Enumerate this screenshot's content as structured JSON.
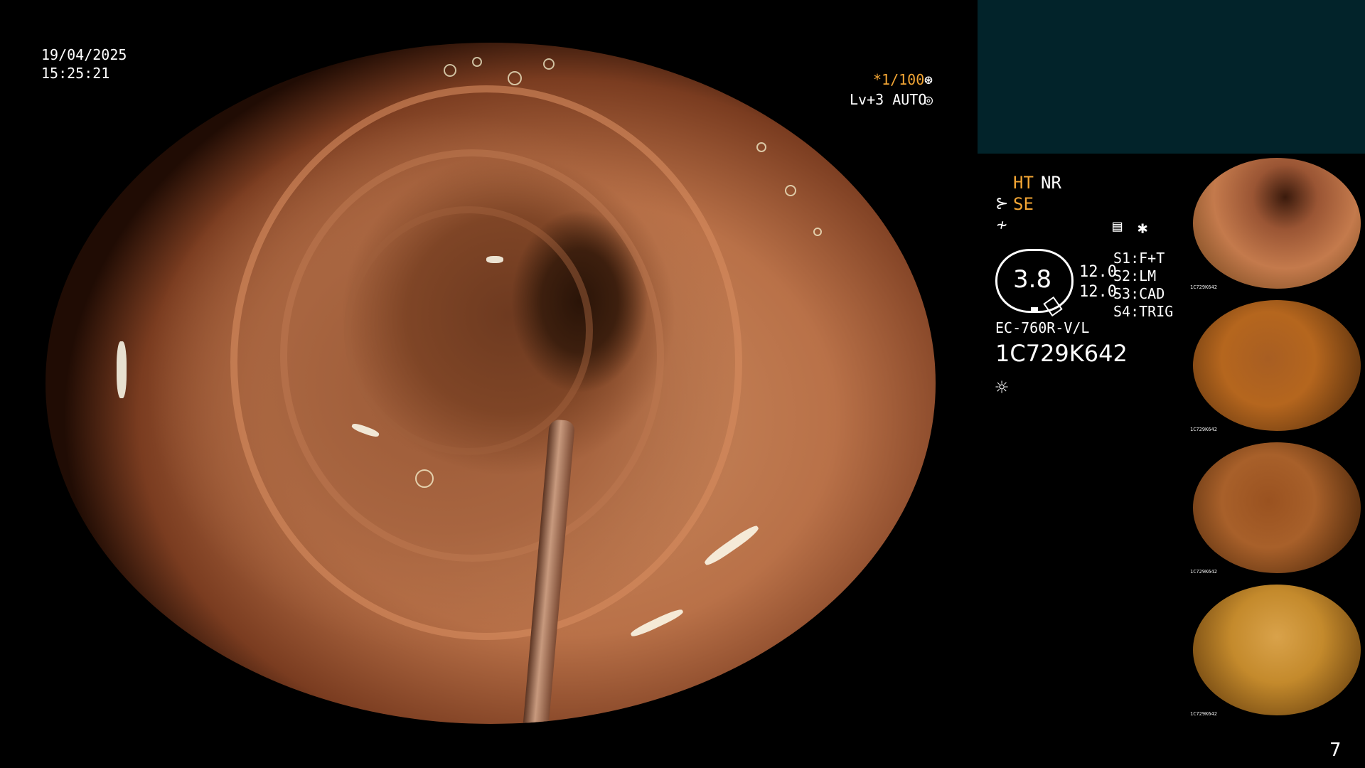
{
  "overlay": {
    "date": "19/04/2025",
    "time": "15:25:21",
    "shutter": "*1/100",
    "level": "Lv+3 AUTO"
  },
  "settings": {
    "ht": "HT",
    "nr": "NR",
    "se": "SE",
    "gauge_value": "3.8",
    "value_top": "12.0",
    "value_bottom": "12.0",
    "switches": [
      "S1:F+T",
      "S2:LM",
      "S3:CAD",
      "S4:TRIG"
    ],
    "scope_model": "EC-760R-V/L",
    "serial": "1C729K642"
  },
  "thumbnails": [
    {
      "label": "1C729K642"
    },
    {
      "label": "1C729K642"
    },
    {
      "label": "1C729K642"
    },
    {
      "label": "1C729K642"
    }
  ],
  "page_number": "7",
  "colors": {
    "accent": "#f2a534",
    "panel": "#02232a"
  }
}
